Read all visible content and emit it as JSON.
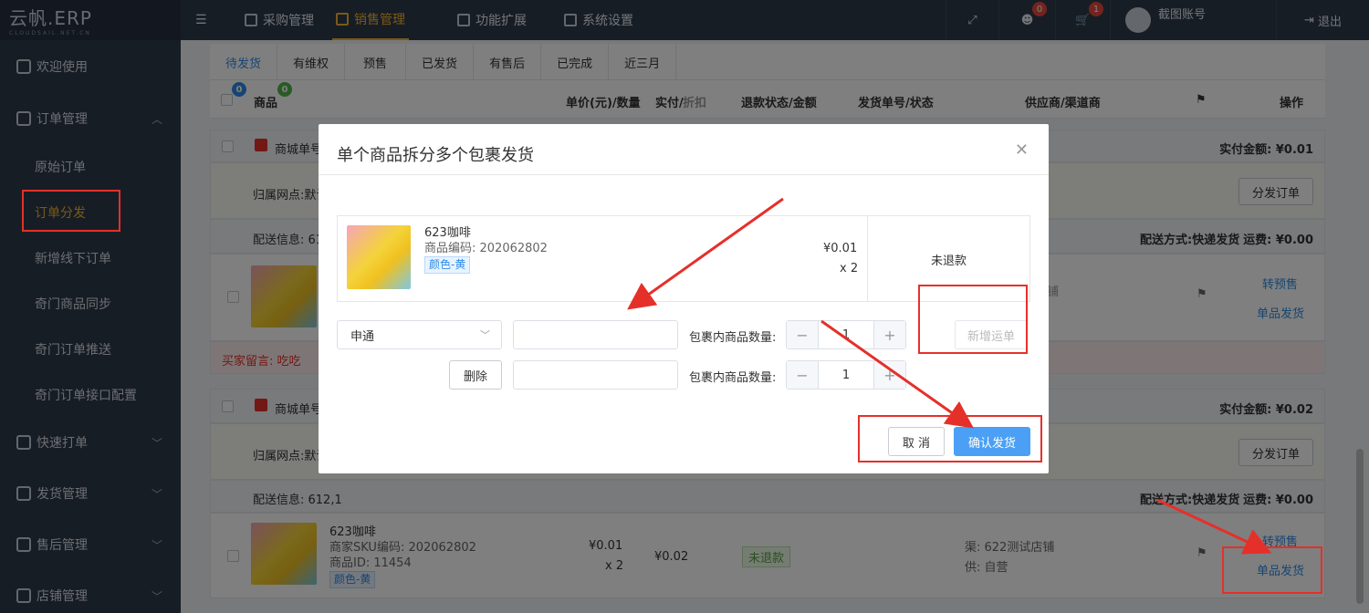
{
  "sidebar": {
    "logo": "云帆.ERP",
    "logo_sub": "CLOUDSAIL.NET.CN",
    "items": [
      {
        "label": "欢迎使用"
      },
      {
        "label": "订单管理"
      },
      {
        "label": "快速打单"
      },
      {
        "label": "发货管理"
      },
      {
        "label": "售后管理"
      },
      {
        "label": "店铺管理"
      }
    ],
    "sub_items": [
      {
        "label": "原始订单"
      },
      {
        "label": "订单分发"
      },
      {
        "label": "新增线下订单"
      },
      {
        "label": "奇门商品同步"
      },
      {
        "label": "奇门订单推送"
      },
      {
        "label": "奇门订单接口配置"
      }
    ]
  },
  "topbar": {
    "menu": [
      "采购管理",
      "销售管理",
      "功能扩展",
      "系统设置"
    ],
    "msg_count": "0",
    "cart_count": "1",
    "account": "截图账号",
    "logout": "退出"
  },
  "tabs": [
    "待发货",
    "有维权",
    "预售",
    "已发货",
    "有售后",
    "已完成",
    "近三月"
  ],
  "table_header": {
    "count_a": "0",
    "count_b": "0",
    "cols": [
      "商品",
      "单价(元)/数量",
      "实付/",
      "折扣",
      "退款状态/金额",
      "发货单号/状态",
      "供应商/渠道商",
      "操作"
    ]
  },
  "orders": [
    {
      "store_no": "商城单号",
      "paid_label": "实付金额: ¥0.01",
      "branch": "归属网点:默认",
      "dispatch_btn": "分发订单",
      "delivery": "配送信息: 61",
      "ship_method": "配送方式:快递发货",
      "freight": "运费: ¥0.00",
      "op1": "转预售",
      "op2": "单品发货",
      "remark": "买家留言: 吃吃",
      "supplier_partial": "铺"
    },
    {
      "store_no": "商城单号",
      "paid_label": "实付金额: ¥0.02",
      "branch": "归属网点:默认",
      "dispatch_btn": "分发订单",
      "delivery": "配送信息: 612,1",
      "ship_method": "配送方式:快递发货",
      "freight": "运费: ¥0.00",
      "product_name": "623咖啡",
      "sku": "商家SKU编码: 202062802",
      "product_id": "商品ID: 11454",
      "color": "颜色-黄",
      "price": "¥0.01",
      "qty": "x 2",
      "paid": "¥0.02",
      "refund": "未退款",
      "channel": "渠:  622测试店铺",
      "supply": "供:  自营",
      "op1": "转预售",
      "op2": "单品发货"
    }
  ],
  "modal": {
    "title": "单个商品拆分多个包裹发货",
    "product_name": "623咖啡",
    "product_code": "商品编码: 202062802",
    "color": "颜色-黄",
    "price": "¥0.01",
    "qty": "x 2",
    "refund_status": "未退款",
    "courier": "申通",
    "pkg_label": "包裹内商品数量:",
    "qty1": "1",
    "qty2": "1",
    "add_btn": "新增运单",
    "delete_btn": "删除",
    "cancel_btn": "取 消",
    "confirm_btn": "确认发货"
  },
  "colors": {
    "accent": "#f2b531",
    "primary": "#4ba0f5",
    "annotation": "#e5302a"
  }
}
